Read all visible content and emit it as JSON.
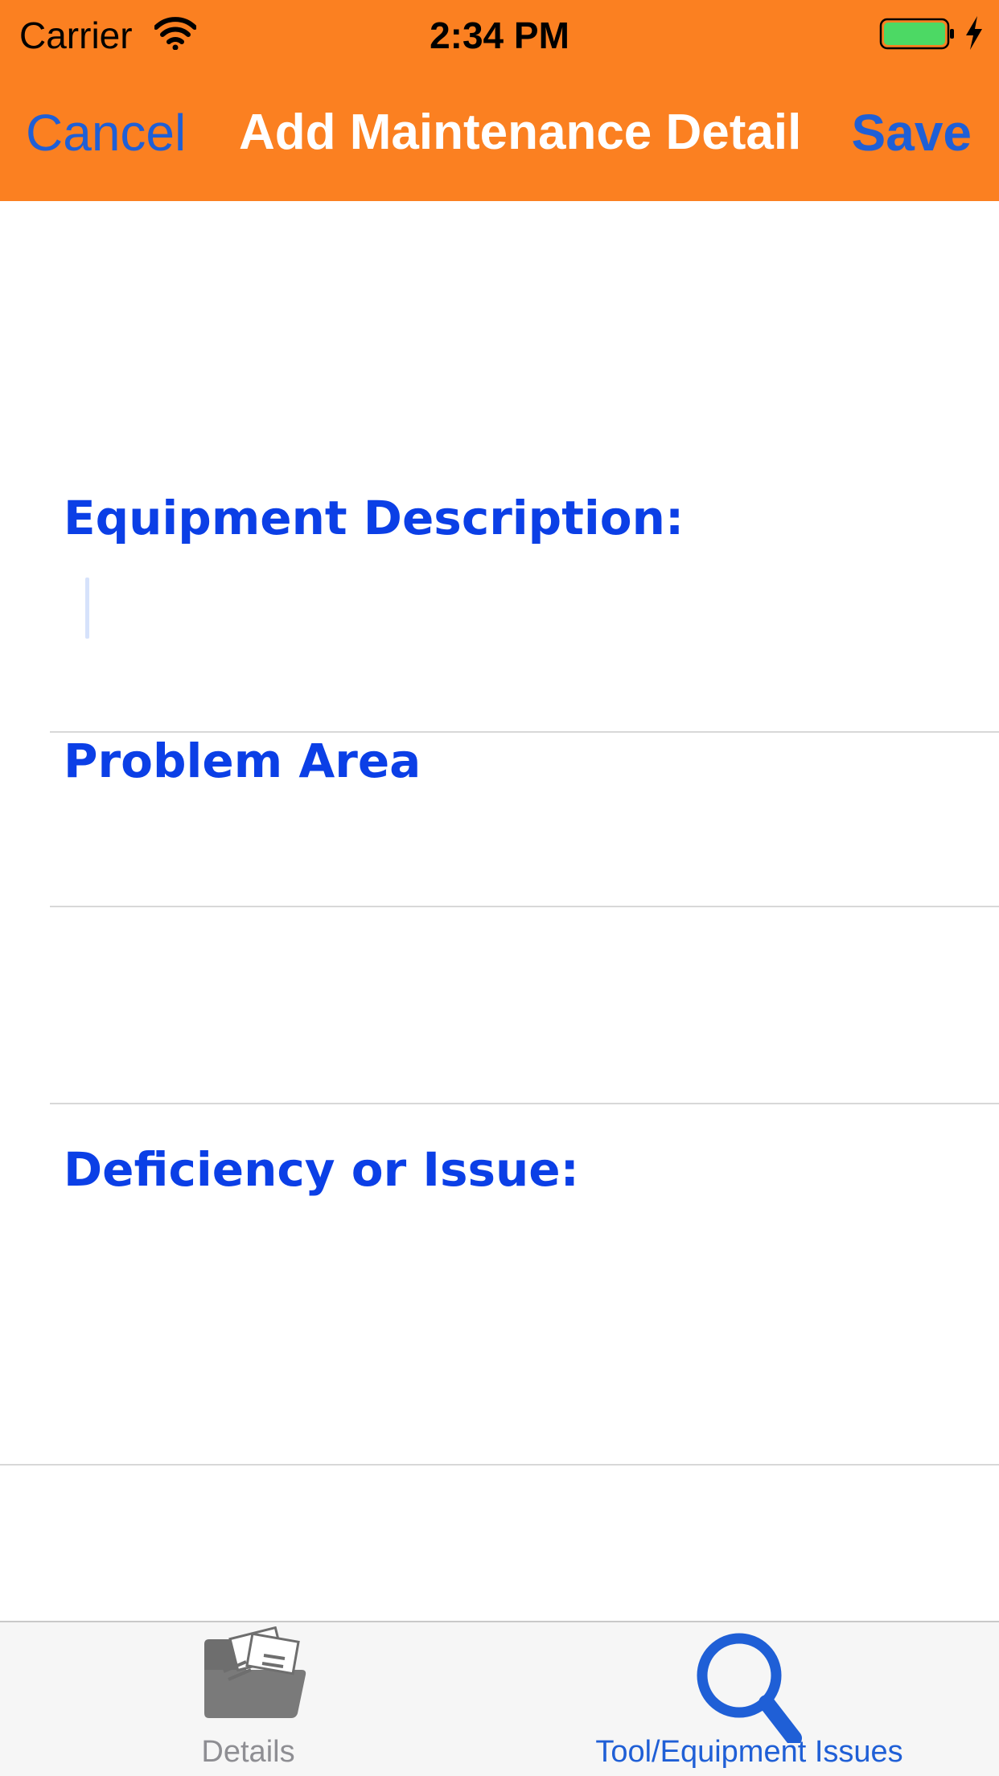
{
  "status_bar": {
    "carrier": "Carrier",
    "time": "2:34 PM",
    "icons": [
      "wifi-icon",
      "battery-icon",
      "charging-icon"
    ]
  },
  "nav": {
    "cancel_label": "Cancel",
    "title": "Add Maintenance Detail",
    "save_label": "Save"
  },
  "form": {
    "equipment_label": "Equipment Description:",
    "equipment_value": "",
    "problem_label": "Problem Area",
    "problem_value": "",
    "extra_value": "",
    "deficiency_label": "Deficiency or Issue:",
    "deficiency_value": ""
  },
  "tabs": [
    {
      "label": "Details",
      "icon": "folder-icon",
      "selected": false
    },
    {
      "label": "Tool/Equipment Issues",
      "icon": "search-icon",
      "selected": true
    }
  ],
  "colors": {
    "header": "#FB8021",
    "nav_button": "#1F5FD6",
    "field_label": "#0B3FE6",
    "tab_active": "#1F5FD6",
    "tab_inactive": "#8E8E93",
    "battery": "#4CD964"
  }
}
